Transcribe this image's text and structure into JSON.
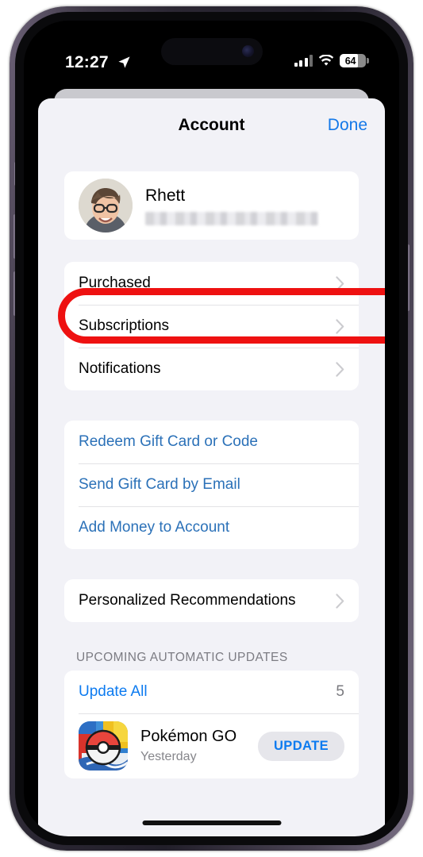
{
  "status_bar": {
    "time": "12:27",
    "location_icon": "location-arrow-icon",
    "signal_icon": "cellular-signal-icon",
    "wifi_icon": "wifi-icon",
    "battery_level": "64"
  },
  "sheet": {
    "title": "Account",
    "done_label": "Done"
  },
  "profile": {
    "name": "Rhett",
    "email": "",
    "email_state": "redacted"
  },
  "menu": {
    "items": [
      {
        "label": "Purchased",
        "accessory": "chevron-right-icon",
        "highlighted": true
      },
      {
        "label": "Subscriptions",
        "accessory": "chevron-right-icon",
        "highlighted": false
      },
      {
        "label": "Notifications",
        "accessory": "chevron-right-icon",
        "highlighted": false
      }
    ]
  },
  "gift_actions": {
    "items": [
      {
        "label": "Redeem Gift Card or Code"
      },
      {
        "label": "Send Gift Card by Email"
      },
      {
        "label": "Add Money to Account"
      }
    ]
  },
  "recommendations": {
    "label": "Personalized Recommendations",
    "accessory": "chevron-right-icon"
  },
  "updates": {
    "section_header": "UPCOMING AUTOMATIC UPDATES",
    "update_all_label": "Update All",
    "update_all_count": "5",
    "apps": [
      {
        "name": "Pokémon GO",
        "date": "Yesterday",
        "button_label": "UPDATE",
        "icon": "pokemon-go-app-icon"
      }
    ]
  },
  "annotation": {
    "type": "red-oval-highlight",
    "target": "Purchased",
    "color": "#EE1111"
  },
  "colors": {
    "accent_blue": "#0D7BF0",
    "link_blue": "#2B71B8",
    "sheet_background": "#F2F2F7",
    "card_background": "#FFFFFF",
    "annotation_red": "#EE1111"
  }
}
